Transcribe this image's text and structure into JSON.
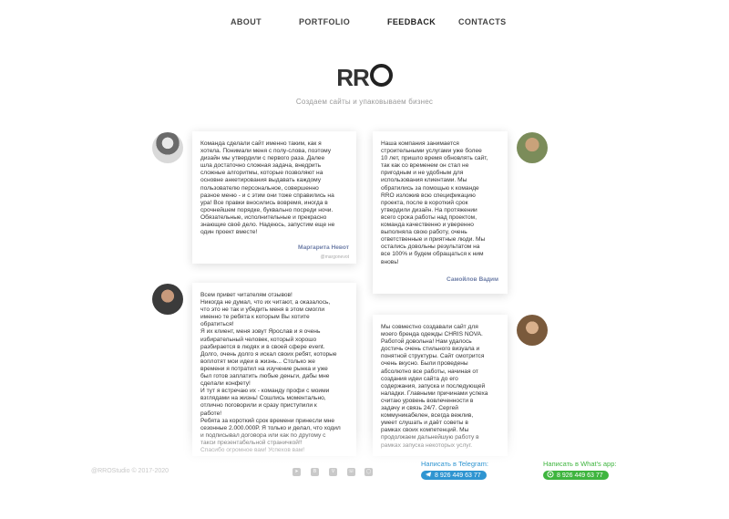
{
  "nav": {
    "about": "ABOUT",
    "portfolio": "PORTFOLIO",
    "feedback": "FEEDBACK",
    "contacts": "CONTACTS"
  },
  "logo": {
    "text": "RR"
  },
  "subtitle": "Создаем сайты и упаковываем бизнес",
  "reviews": [
    {
      "text": "Команда сделали сайт именно таким, как я\nхотела. Понимали меня с полу-слова, поэтому\nдизайн мы утвердили с первого раза. Далее\nшла достаточно сложная задача, внедрить\nсложные алгоритмы, которые позволяют на\nосновне анкетирования выдавать каждому\nпользователю персональное, совершенно\nразное меню - и с этим они тоже справились на\nура! Все правки вносились вовремя, иногда в\nсрочнейшем порядке, буквально посреди ночи.\nОбязательные, исполнительные и прекрасно\nзнающие своё дело. Надеюсь, запустим еще не\nодин проект вместе!",
      "author": "Маргарита Невот",
      "handle": "@margonevot"
    },
    {
      "text": "Наша компания занимается\nстроительными услугами уже более\n10 лет, пришло время обновлять сайт,\nтак как со временем он стал не\nпригодным и не удобным для\nиспользования клиентами. Мы\nобратились за помощью к команде\nRRO изложив всю спецификацию\nпроекта, после в короткий срок\nутвердили дизайн. На протяжении\nвсего срока работы над проектом,\nкоманда качественно и уверенно\nвыполняла свою работу, очень\nответственные и приятные люди. Мы\nостались довольны результатом на\nвсе 100% и будем обращаться к ним\nвновь!",
      "author": "Самойлов Вадим"
    },
    {
      "text": "Всем привет читателям отзывов!\nНикогда не думал, что их читают, а оказалось,\nчто это не так и убедить меня в этом смогли\nименно те ребята к которым Вы хотите\nобратиться!\nЯ их клиент, меня зовут Ярослав и я очень\nизбирательный человек, который хорошо\nразбирается в людях и в своей сфере event.\nДолго, очень долго я искал своих ребят, которые\nвоплотят мои идеи в жизнь... Столько же\nвремени я потратил на изучение рынка и уже\nбыл готов заплатить любые деньги, дабы мне\nсделали конфету!\nИ тут я встречаю их - команду профи с моими\nвзглядами на жизнь! Сошлись моментально,\nотлично поговорили и сразу приступили к\nработе!\nРебята за короткий срок времени принесли мне\nсезонные 2.000.000Р. Я только и делал, что ходил\nи подписывал договора или как по другому с\nтакси презентабельной страничкой!!\nСпасибо огромное вам! Успехов вам!",
      "author": ""
    },
    {
      "text": "Мы совместно создавали сайт для\nмоего бренда одежды CHRIS NOVA.\nРаботой довольна! Нам удалось\nдостичь очень стильного визуала и\nпонятной структуры. Сайт смотрится\nочень вкусно. Были проведены\nабсолютно все работы, начиная от\nсоздания идеи сайта до его\nсодержания, запуска и последующей\nналадки. Главными причинами успеха\nсчитаю уровень вовлеченности в\nзадачу и связь 24/7. Сергей\nкоммуникабелен, всегда вежлив,\nумеет слушать и даёт советы в\nрамках своих компетенций. Мы\nпродолжаем дальнейшую работу в\nрамках запуска некоторых услуг.",
      "author": ""
    }
  ],
  "footer": {
    "copyright": "@RROStudio © 2017-2020",
    "telegram_label": "Написать в Telegram:",
    "telegram_phone": "8 926 449 63 77",
    "whatsapp_label": "Написать в What's app:",
    "whatsapp_phone": "8 926 449 63 77",
    "socials": [
      "telegram-icon",
      "behance-icon",
      "vk-icon",
      "whatsapp-icon",
      "instagram-icon"
    ]
  },
  "colors": {
    "telegram": "#2f95d1",
    "whatsapp": "#3fb53f",
    "author": "#6f7fa8"
  }
}
